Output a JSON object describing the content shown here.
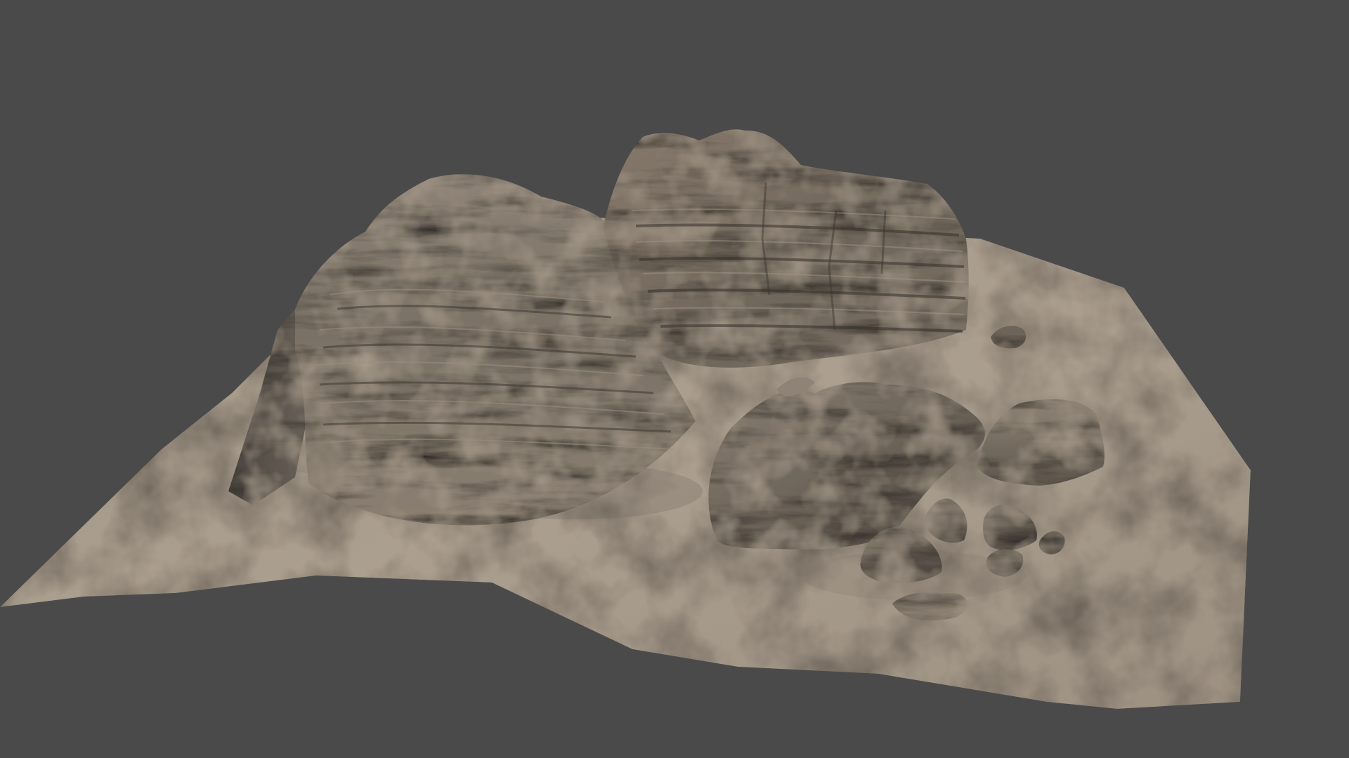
{
  "viewport": {
    "background_color": "#4a4a4a"
  },
  "scene": {
    "subject": "sandstone-terrain-render",
    "colors": {
      "ground_light": "#a89c8c",
      "ground_mid": "#918678",
      "ground_shadow": "#6c645a",
      "rock_light": "#8f8578",
      "rock_mid": "#726a5f",
      "rock_dark": "#4f4942",
      "rock_crevice": "#3a3530"
    }
  }
}
